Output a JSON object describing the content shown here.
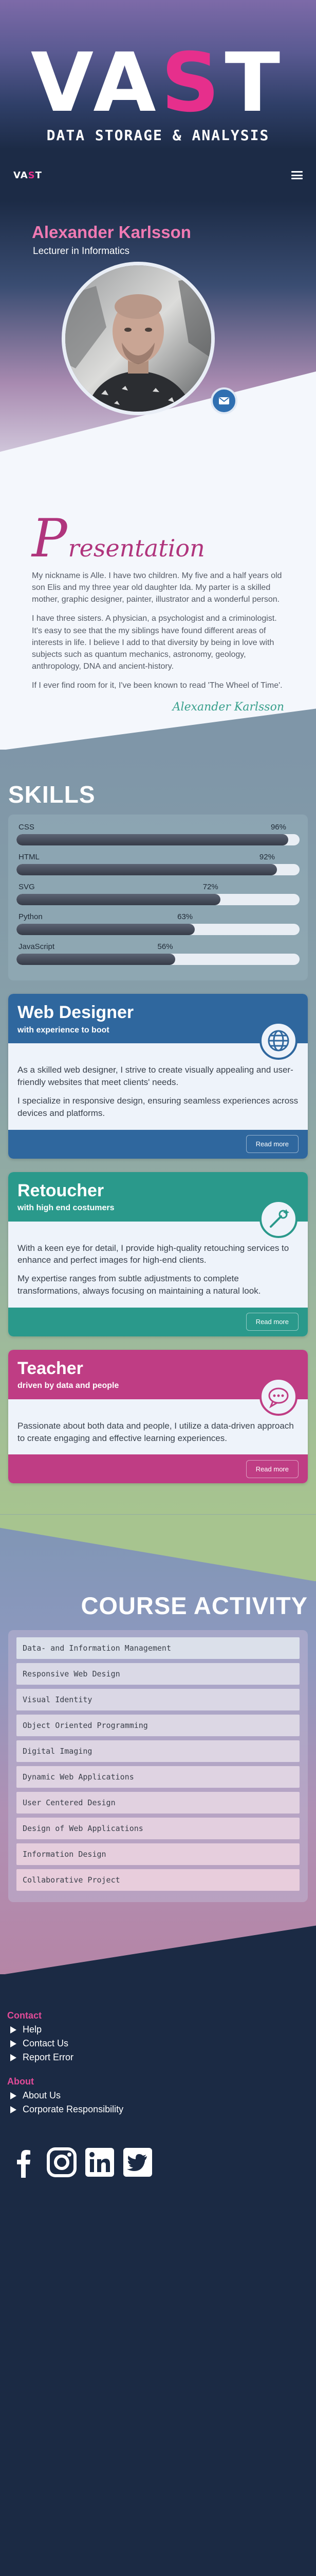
{
  "hero": {
    "title_part1": "VA",
    "title_accent": "S",
    "title_part2": "T",
    "subtitle": "DATA STORAGE & ANALYSIS"
  },
  "nav": {
    "logo_part1": "VA",
    "logo_accent": "S",
    "logo_part2": "T",
    "menu_icon": "hamburger-icon"
  },
  "profile": {
    "name": "Alexander Karlsson",
    "role": "Lecturer in Informatics",
    "mail_icon": "envelope-icon"
  },
  "presentation": {
    "title_initial": "P",
    "title_rest": "resentation",
    "paragraphs": [
      "My nickname is Alle. I have two children. My five and a half years old son Elis and my three year old daughter Ida. My parter is a skilled mother, graphic designer, painter, illustrator and a wonderful person.",
      "I have three sisters. A physician, a psychologist and a criminologist. It's easy to see that the my siblings have found different areas of interests in life. I believe I add to that diversity by being in love with subjects such as quantum mechanics, astronomy, geology, anthropology, DNA and ancient-history.",
      "If I ever find room for it, I've been known to read 'The Wheel of Time'."
    ],
    "signature": "Alexander Karlsson"
  },
  "skills": {
    "title": "SKILLS",
    "items": [
      {
        "name": "CSS",
        "value": 96,
        "label": "96%"
      },
      {
        "name": "HTML",
        "value": 92,
        "label": "92%"
      },
      {
        "name": "SVG",
        "value": 72,
        "label": "72%"
      },
      {
        "name": "Python",
        "value": 63,
        "label": "63%"
      },
      {
        "name": "JavaScript",
        "value": 56,
        "label": "56%"
      }
    ]
  },
  "services": [
    {
      "title": "Web Designer",
      "subtitle": "with experience to boot",
      "color": "#2f679e",
      "icon": "globe-icon",
      "paragraphs": [
        "As a skilled web designer, I strive to create visually appealing and user-friendly websites that meet clients' needs.",
        "I specialize in responsive design, ensuring seamless experiences across devices and platforms."
      ],
      "button": "Read more"
    },
    {
      "title": "Retoucher",
      "subtitle": "with high end costumers",
      "color": "#2a998b",
      "icon": "magic-wand-icon",
      "paragraphs": [
        "With a keen eye for detail, I provide high-quality retouching services to enhance and perfect images for high-end clients.",
        "My expertise ranges from subtle adjustments to complete transformations, always focusing on maintaining a natural look."
      ],
      "button": "Read more"
    },
    {
      "title": "Teacher",
      "subtitle": "driven by data and people",
      "color": "#bf3d84",
      "icon": "chat-bubble-icon",
      "paragraphs": [
        "Passionate about both data and people, I utilize a data-driven approach to create engaging and effective learning experiences."
      ],
      "button": "Read more"
    }
  ],
  "courses": {
    "title": "COURSE ACTIVITY",
    "items": [
      "Data- and Information Management",
      "Responsive Web Design",
      "Visual Identity",
      "Object Oriented Programming",
      "Digital Imaging",
      "Dynamic Web Applications",
      "User Centered Design",
      "Design of Web Applications",
      "Information Design",
      "Collaborative Project"
    ],
    "item_colors": [
      "#dbe0ea",
      "#dad9e6",
      "#dad7e5",
      "#dcd7e4",
      "#ddd5e3",
      "#dfd3e2",
      "#e1d1e0",
      "#e3cfdf",
      "#e6cedd",
      "#e8cddc"
    ]
  },
  "footer": {
    "contact": {
      "heading": "Contact",
      "links": [
        "Help",
        "Contact Us",
        "Report Error"
      ]
    },
    "about": {
      "heading": "About",
      "links": [
        "About Us",
        "Corporate Responsibility"
      ]
    },
    "socials": [
      "facebook-icon",
      "instagram-icon",
      "linkedin-icon",
      "twitter-icon"
    ]
  }
}
